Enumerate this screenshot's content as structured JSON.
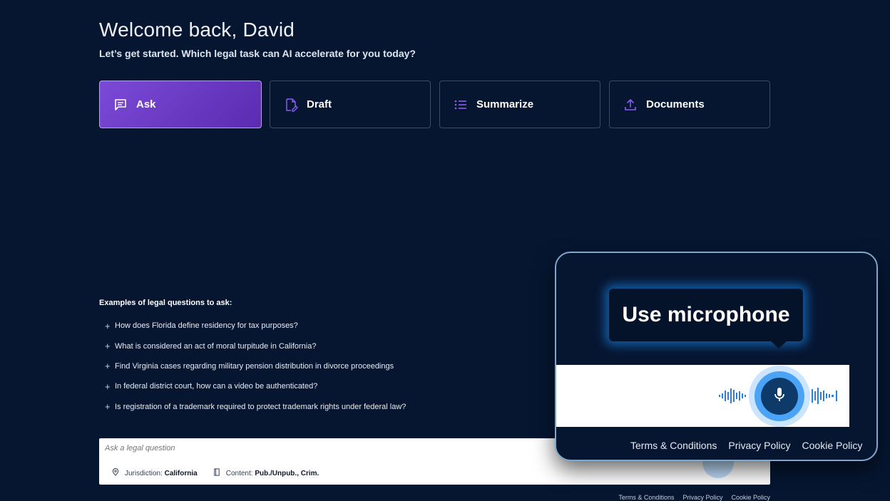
{
  "header": {
    "greeting": "Welcome back, David",
    "subtitle": "Let’s get started. Which legal task can AI accelerate for you today?"
  },
  "tasks": [
    {
      "label": "Ask",
      "icon": "chat-icon",
      "active": true
    },
    {
      "label": "Draft",
      "icon": "document-edit-icon",
      "active": false
    },
    {
      "label": "Summarize",
      "icon": "list-icon",
      "active": false
    },
    {
      "label": "Documents",
      "icon": "upload-icon",
      "active": false
    }
  ],
  "examples": {
    "title": "Examples of legal questions to ask:",
    "items": [
      "How does Florida define residency for tax purposes?",
      "What is considered an act of moral turpitude in California?",
      "Find Virginia cases regarding military pension distribution in divorce proceedings",
      "In federal district court, how can a video be authenticated?",
      "Is registration of a trademark required to protect trademark rights under federal law?"
    ]
  },
  "ask": {
    "placeholder": "Ask a legal question",
    "jurisdiction_label": "Jurisdiction:",
    "jurisdiction_value": "California",
    "content_label": "Content:",
    "content_value": "Pub./Unpub., Crim."
  },
  "footer": {
    "links": [
      "Terms & Conditions",
      "Privacy Policy",
      "Cookie Policy"
    ]
  },
  "zoom": {
    "tooltip": "Use microphone",
    "links": [
      "Terms & Conditions",
      "Privacy Policy",
      "Cookie Policy"
    ]
  },
  "colors": {
    "background": "#061631",
    "accent": "#6a3bc9",
    "icon": "#8b5cf6",
    "mic": "#0d3a68"
  }
}
